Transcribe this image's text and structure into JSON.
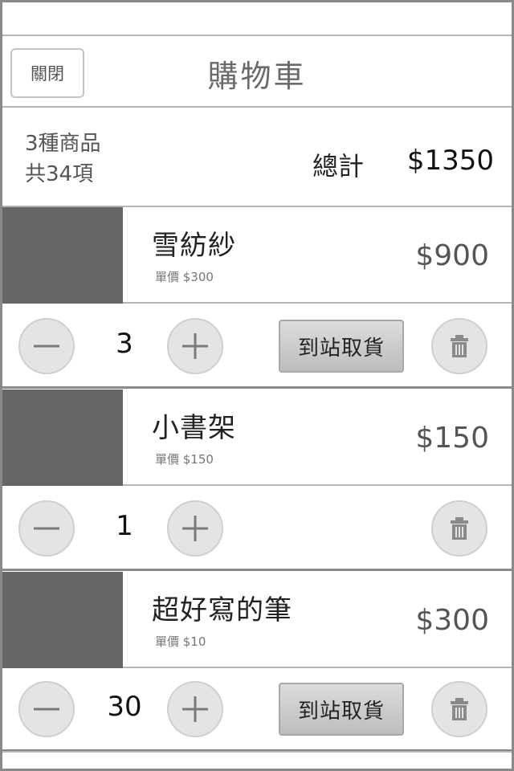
{
  "nav": {
    "close_label": "關閉",
    "title": "購物車"
  },
  "summary": {
    "kinds": "3種商品",
    "count": "共34項",
    "total_label": "總計",
    "total": "$1350"
  },
  "items": [
    {
      "name": "雪紡紗",
      "unit_price": "單價 $300",
      "price": "$900",
      "qty": "3",
      "pickup_label": "到站取貨",
      "has_pickup": true
    },
    {
      "name": "小書架",
      "unit_price": "單價 $150",
      "price": "$150",
      "qty": "1",
      "pickup_label": "",
      "has_pickup": false
    },
    {
      "name": "超好寫的筆",
      "unit_price": "單價 $10",
      "price": "$300",
      "qty": "30",
      "pickup_label": "到站取貨",
      "has_pickup": true
    }
  ],
  "icons": {
    "minus": "minus-icon",
    "plus": "plus-icon",
    "trash": "trash-icon"
  },
  "colors": {
    "thumb": "#666666",
    "button_bg": "#e4e4e4",
    "divider": "#b5b5b5"
  }
}
